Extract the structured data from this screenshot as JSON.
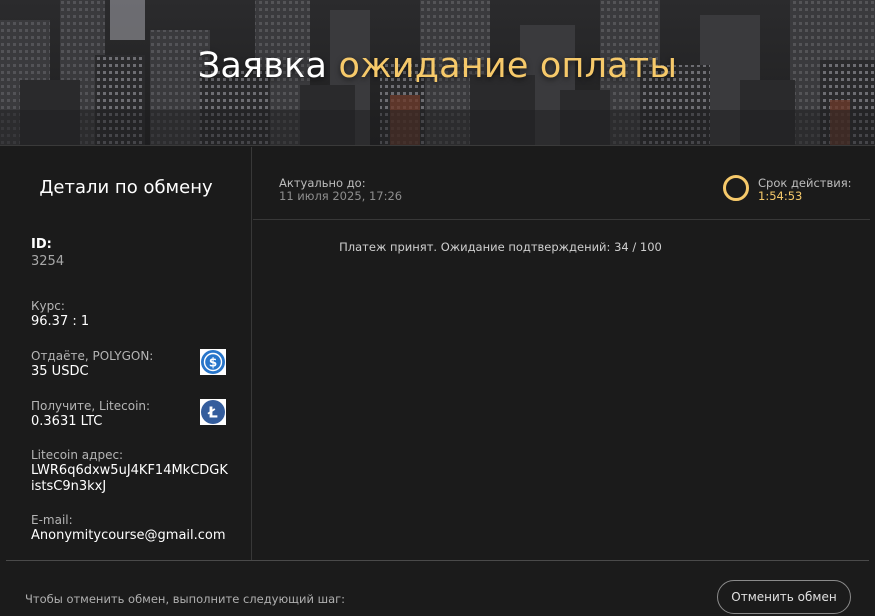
{
  "banner": {
    "title_main": "Заявка",
    "title_accent": "ожидание оплаты"
  },
  "sidebar": {
    "title": "Детали по обмену",
    "id_label": "ID:",
    "id_value": "3254",
    "rate_label": "Курс:",
    "rate_value": "96.37 : 1",
    "give_label": "Отдаёте, POLYGON:",
    "give_value": "35 USDC",
    "give_icon": "usdc-icon",
    "receive_label": "Получите, Litecoin:",
    "receive_value": "0.3631 LTC",
    "receive_icon": "litecoin-icon",
    "address_label": "Litecoin адрес:",
    "address_line1": "LWR6q6dxw5uJ4KF14MkCDGK",
    "address_line2": "istsC9n3kxJ",
    "email_label": "E-mail:",
    "email_value": "Anonymitycourse@gmail.com"
  },
  "content": {
    "actual_label": "Актуально до:",
    "actual_date": "11 июля 2025, 17:26",
    "timer_label": "Срок действия:",
    "timer_value": "1:54:53",
    "status_text": "Платеж принят. Ожидание подтверждений: 34 / 100"
  },
  "footer": {
    "cancel_note": "Чтобы отменить обмен, выполните следующий шаг:",
    "cancel_button": "Отменить обмен"
  },
  "colors": {
    "accent": "#f6c96a",
    "background": "#1b1b1b",
    "usdc_blue": "#2775ca",
    "litecoin_blue": "#345d9d"
  }
}
